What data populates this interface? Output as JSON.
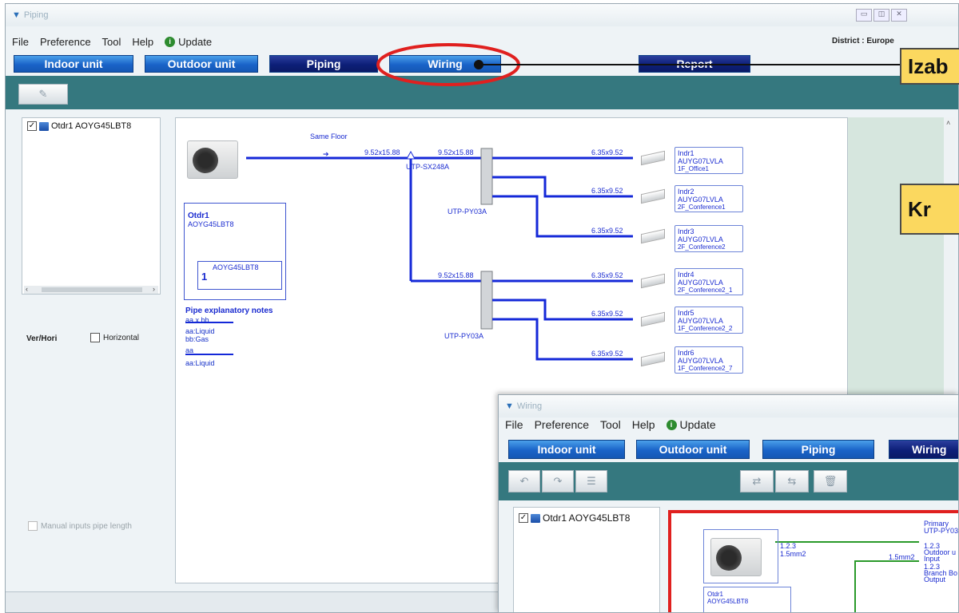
{
  "piping_window": {
    "title": "Piping",
    "menu": [
      "File",
      "Preference",
      "Tool",
      "Help"
    ],
    "update_label": "Update",
    "district": "District : Europe",
    "tabs": {
      "indoor": "Indoor unit",
      "outdoor": "Outdoor unit",
      "piping": "Piping",
      "wiring": "Wiring",
      "report": "Report"
    },
    "tree_item": "Otdr1 AOYG45LBT8",
    "ver_hori_label": "Ver/Hori",
    "horizontal_label": "Horizontal",
    "manual_inputs_label": "Manual inputs pipe length",
    "diagram": {
      "same_floor": "Same Floor",
      "outdoor_name": "Otdr1",
      "outdoor_model": "AOYG45LBT8",
      "outdoor_inner_model": "AOYG45LBT8",
      "outdoor_inner_count": "1",
      "pipe_notes_title": "Pipe explanatory notes",
      "pipe_notes_lines": [
        "aa x bb",
        "aa:Liquid",
        "bb:Gas",
        "aa",
        "aa:Liquid"
      ],
      "main_pipe_1": "9.52x15.88",
      "main_pipe_2": "9.52x15.88",
      "main_pipe_3": "9.52x15.88",
      "separation_tube": "UTP-SX248A",
      "header_1": "UTP-PY03A",
      "header_2": "UTP-PY03A",
      "branch_pipe": "6.35x9.52",
      "indoor_units": [
        {
          "name": "Indr1",
          "model": "AUYG07LVLA",
          "room": "1F_Office1"
        },
        {
          "name": "Indr2",
          "model": "AUYG07LVLA",
          "room": "2F_Conference1"
        },
        {
          "name": "Indr3",
          "model": "AUYG07LVLA",
          "room": "2F_Conference2"
        },
        {
          "name": "Indr4",
          "model": "AUYG07LVLA",
          "room": "2F_Conference2_1"
        },
        {
          "name": "Indr5",
          "model": "AUYG07LVLA",
          "room": "1F_Conference2_2"
        },
        {
          "name": "Indr6",
          "model": "AUYG07LVLA",
          "room": "1F_Conference2_7"
        }
      ]
    }
  },
  "wiring_window": {
    "title": "Wiring",
    "menu": [
      "File",
      "Preference",
      "Tool",
      "Help"
    ],
    "update_label": "Update",
    "tabs": {
      "indoor": "Indoor unit",
      "outdoor": "Outdoor unit",
      "piping": "Piping",
      "wiring": "Wiring"
    },
    "tree_item": "Otdr1 AOYG45LBT8",
    "diagram": {
      "primary": "Primary",
      "primary_model": "UTP-PY03",
      "wire_a": "1.2.3",
      "wire_a_size": "1.5mm2",
      "wire_b_size": "1.5mm2",
      "outdoor_input_num": "1.2.3",
      "outdoor_input": "Outdoor u",
      "input": "Input",
      "branch_num": "1.2.3",
      "branch_box": "Branch Bo",
      "output": "Output",
      "outdoor_name": "Otdr1",
      "outdoor_model": "AOYG45LBT8"
    }
  },
  "callouts": {
    "top": "Izab",
    "middle": "Kr"
  },
  "colors": {
    "tab_blue": "#1a63c8",
    "tab_dark": "#0d1f78",
    "teal": "#35787f",
    "pipe_blue": "#1428d8",
    "wire_green": "#2a9a2a",
    "highlight_red": "#e0201f",
    "callout_yellow": "#fbd85f"
  }
}
